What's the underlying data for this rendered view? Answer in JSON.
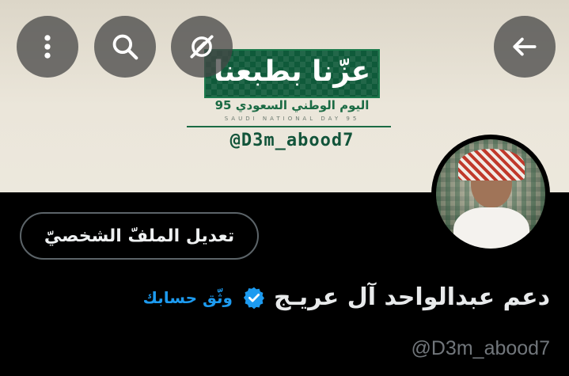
{
  "banner": {
    "logo_text": "عزّنا بطبعنا",
    "subtitle_ar": "اليوم الوطني السعودي 95",
    "subtitle_en": "SAUDI NATIONAL DAY 95",
    "handle": "@D3m_abood7"
  },
  "header": {
    "more_icon": "more-vertical-icon",
    "search_icon": "search-icon",
    "translate_icon": "no-translate-icon",
    "back_icon": "arrow-back-icon"
  },
  "profile": {
    "edit_button": "تعديل الملفّ الشخصيّ",
    "display_name": "دعم عبدالواحد آل عريـج",
    "verify_link": "وثّق حسابك",
    "handle": "@D3m_abood7"
  },
  "colors": {
    "accent": "#1d9bf0",
    "background": "#000000",
    "muted": "#71767b"
  }
}
